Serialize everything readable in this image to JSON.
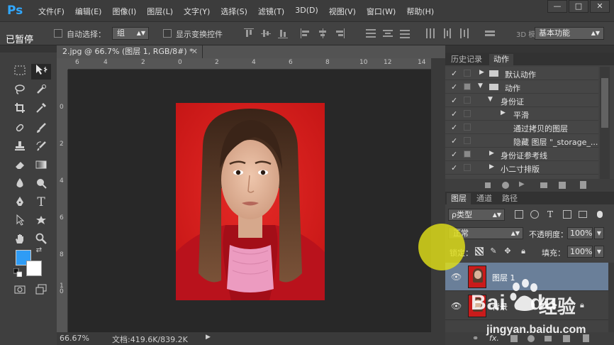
{
  "app": {
    "logo": "Ps",
    "menu": [
      "文件(F)",
      "编辑(E)",
      "图像(I)",
      "图层(L)",
      "文字(Y)",
      "选择(S)",
      "滤镜(T)",
      "3D(D)",
      "视图(V)",
      "窗口(W)",
      "帮助(H)"
    ],
    "window_controls": [
      "—",
      "□",
      "✕"
    ]
  },
  "options_bar": {
    "overlay_text": "已暂停",
    "auto_select_label": "自动选择：",
    "auto_select_value": "组",
    "show_transform_label": "显示变换控件",
    "mode_3d_label": "3D 模式：",
    "workspace": "基本功能"
  },
  "document": {
    "tab_title": "2.jpg @ 66.7% (图层 1, RGB/8#) *",
    "tab_close": "✕",
    "ruler_h_labels": [
      "6",
      "4",
      "2",
      "0",
      "2",
      "4",
      "6",
      "8",
      "10",
      "12",
      "14"
    ],
    "ruler_v_labels": [
      "0",
      "2",
      "4",
      "6",
      "8",
      "1",
      "0"
    ]
  },
  "status_bar": {
    "zoom": "66.67%",
    "doc_info": "文档:419.6K/839.2K",
    "arrow": "▶"
  },
  "panels": {
    "top_tabs": [
      "历史记录",
      "动作"
    ],
    "actions": [
      {
        "label": "默认动作",
        "level": 0,
        "expanded": false,
        "folder": true,
        "dialog": false
      },
      {
        "label": "动作",
        "level": 0,
        "expanded": true,
        "folder": true,
        "dialog": true
      },
      {
        "label": "身份证",
        "level": 1,
        "expanded": true,
        "folder": false,
        "dialog": false
      },
      {
        "label": "平滑",
        "level": 2,
        "expanded": false,
        "folder": false,
        "dialog": false
      },
      {
        "label": "通过拷贝的图层",
        "level": 3,
        "expanded": null,
        "folder": false,
        "dialog": false
      },
      {
        "label": "隐藏 图层 \"_storage_...",
        "level": 3,
        "expanded": null,
        "folder": false,
        "dialog": false
      },
      {
        "label": "身份证参考线",
        "level": 1,
        "expanded": false,
        "folder": false,
        "dialog": true
      },
      {
        "label": "小二寸排版",
        "level": 1,
        "expanded": false,
        "folder": false,
        "dialog": false
      }
    ],
    "checkmark": "✓",
    "layer_tabs": [
      "图层",
      "通道",
      "路径"
    ],
    "layer_filter": "ρ类型",
    "blend_mode": "正常",
    "opacity_label": "不透明度：",
    "opacity_value": "100%",
    "lock_label": "锁定：",
    "fill_label": "填充：",
    "fill_value": "100%",
    "layers": [
      {
        "name": "图层 1",
        "selected": true,
        "locked": false
      },
      {
        "name": "背景",
        "selected": false,
        "locked": true
      }
    ]
  },
  "watermark": {
    "brand": "Bai",
    "brand_suffix": "du",
    "product": "经验",
    "url": "jingyan.baidu.com"
  },
  "colors": {
    "accent": "#31a8ff",
    "foreground": "#2f9cf5",
    "background": "#ffffff",
    "photo_bg": "#d21d1d",
    "selected_layer": "#6a7f99",
    "cursor_highlight": "#e0df18"
  }
}
